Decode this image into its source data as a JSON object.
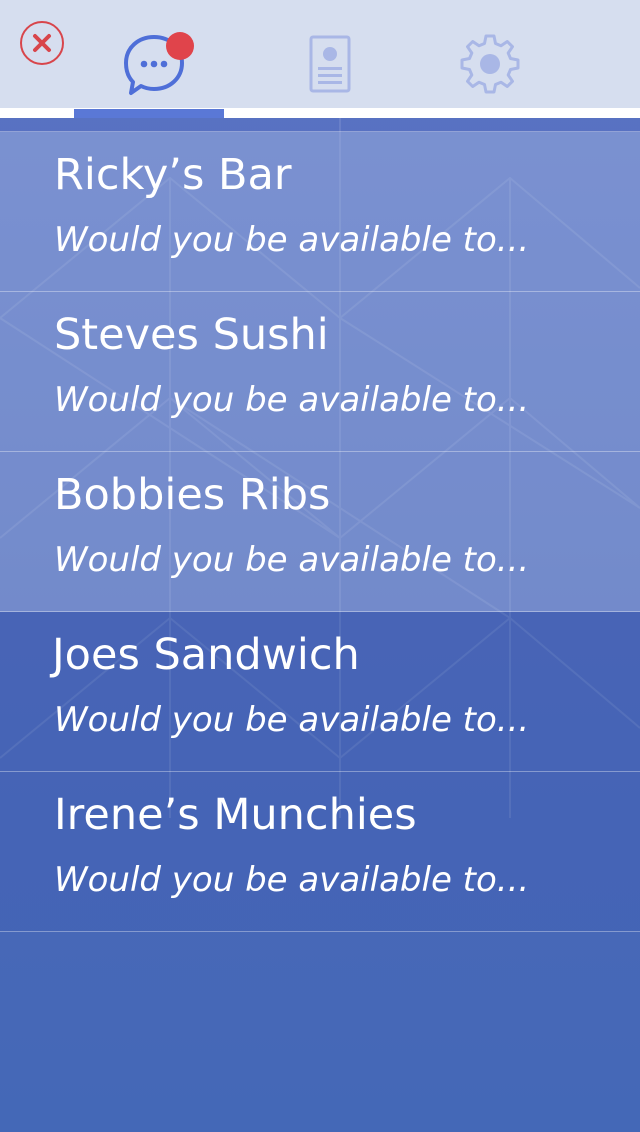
{
  "header": {
    "close_icon": "close-icon",
    "tabs": [
      {
        "name": "messages",
        "icon": "chat-bubble-icon",
        "active": true,
        "has_notification": true
      },
      {
        "name": "profile",
        "icon": "contact-card-icon",
        "active": false
      },
      {
        "name": "settings",
        "icon": "gear-icon",
        "active": false
      }
    ]
  },
  "colors": {
    "header_bg": "#d6deef",
    "accent": "#5a78d6",
    "notification": "#e0444b",
    "close": "#d8454b",
    "inactive_icon": "#a9b7e6"
  },
  "conversations": [
    {
      "title": "Ricky’s Bar",
      "preview": "Would you be available to..."
    },
    {
      "title": "Steves Sushi",
      "preview": "Would you be available to..."
    },
    {
      "title": "Bobbies Ribs",
      "preview": "Would you be available to..."
    },
    {
      "title": "Joes Sandwich",
      "preview": "Would you be available to..."
    },
    {
      "title": "Irene’s Munchies",
      "preview": "Would you be available to..."
    }
  ]
}
